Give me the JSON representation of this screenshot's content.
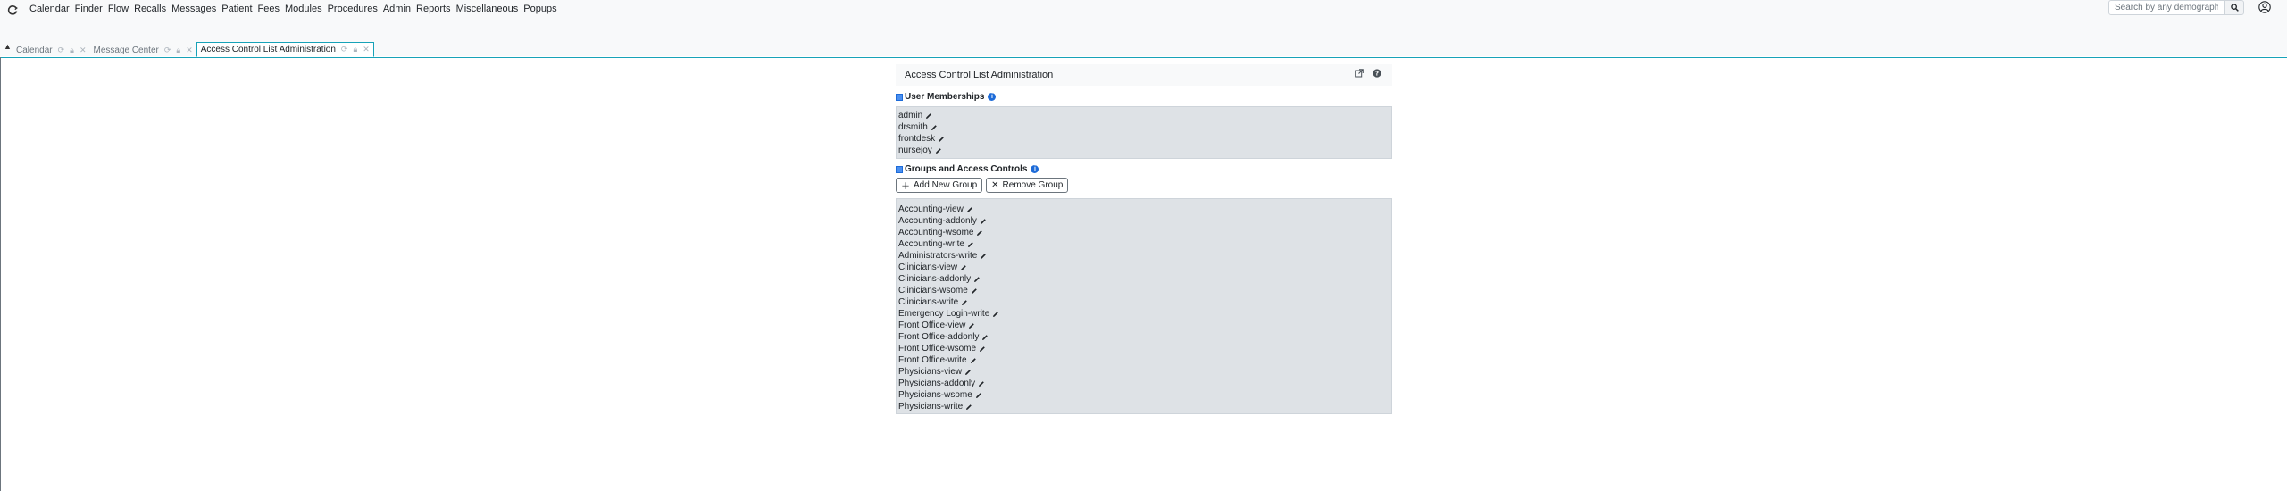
{
  "menu": {
    "items": [
      "Calendar",
      "Finder",
      "Flow",
      "Recalls",
      "Messages",
      "Patient",
      "Fees",
      "Modules",
      "Procedures",
      "Admin",
      "Reports",
      "Miscellaneous",
      "Popups"
    ]
  },
  "search": {
    "placeholder": "Search by any demographic"
  },
  "tabs": [
    {
      "label": "Calendar"
    },
    {
      "label": "Message Center"
    },
    {
      "label": "Access Control List Administration"
    }
  ],
  "page": {
    "title": "Access Control List Administration",
    "user_memberships": {
      "heading": "User Memberships",
      "users": [
        "admin",
        "drsmith",
        "frontdesk",
        "nursejoy"
      ]
    },
    "groups": {
      "heading": "Groups and Access Controls",
      "add_label": "Add New Group",
      "remove_label": "Remove Group",
      "items": [
        "Accounting-view",
        "Accounting-addonly",
        "Accounting-wsome",
        "Accounting-write",
        "Administrators-write",
        "Clinicians-view",
        "Clinicians-addonly",
        "Clinicians-wsome",
        "Clinicians-write",
        "Emergency Login-write",
        "Front Office-view",
        "Front Office-addonly",
        "Front Office-wsome",
        "Front Office-write",
        "Physicians-view",
        "Physicians-addonly",
        "Physicians-wsome",
        "Physicians-write"
      ]
    }
  },
  "colors": {
    "accent": "#17a2b8",
    "info": "#1d6bd8",
    "box_bg": "#dee2e6"
  }
}
